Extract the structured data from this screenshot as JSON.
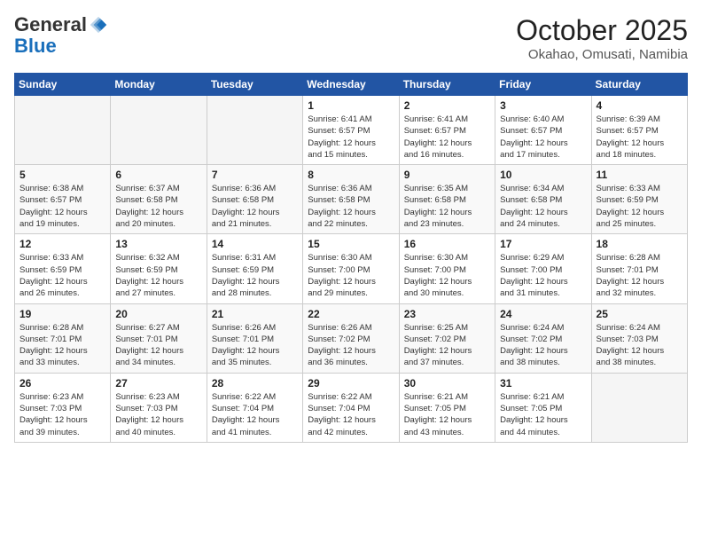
{
  "logo": {
    "general": "General",
    "blue": "Blue"
  },
  "header": {
    "month": "October 2025",
    "location": "Okahao, Omusati, Namibia"
  },
  "days_of_week": [
    "Sunday",
    "Monday",
    "Tuesday",
    "Wednesday",
    "Thursday",
    "Friday",
    "Saturday"
  ],
  "weeks": [
    [
      {
        "day": "",
        "info": ""
      },
      {
        "day": "",
        "info": ""
      },
      {
        "day": "",
        "info": ""
      },
      {
        "day": "1",
        "info": "Sunrise: 6:41 AM\nSunset: 6:57 PM\nDaylight: 12 hours\nand 15 minutes."
      },
      {
        "day": "2",
        "info": "Sunrise: 6:41 AM\nSunset: 6:57 PM\nDaylight: 12 hours\nand 16 minutes."
      },
      {
        "day": "3",
        "info": "Sunrise: 6:40 AM\nSunset: 6:57 PM\nDaylight: 12 hours\nand 17 minutes."
      },
      {
        "day": "4",
        "info": "Sunrise: 6:39 AM\nSunset: 6:57 PM\nDaylight: 12 hours\nand 18 minutes."
      }
    ],
    [
      {
        "day": "5",
        "info": "Sunrise: 6:38 AM\nSunset: 6:57 PM\nDaylight: 12 hours\nand 19 minutes."
      },
      {
        "day": "6",
        "info": "Sunrise: 6:37 AM\nSunset: 6:58 PM\nDaylight: 12 hours\nand 20 minutes."
      },
      {
        "day": "7",
        "info": "Sunrise: 6:36 AM\nSunset: 6:58 PM\nDaylight: 12 hours\nand 21 minutes."
      },
      {
        "day": "8",
        "info": "Sunrise: 6:36 AM\nSunset: 6:58 PM\nDaylight: 12 hours\nand 22 minutes."
      },
      {
        "day": "9",
        "info": "Sunrise: 6:35 AM\nSunset: 6:58 PM\nDaylight: 12 hours\nand 23 minutes."
      },
      {
        "day": "10",
        "info": "Sunrise: 6:34 AM\nSunset: 6:58 PM\nDaylight: 12 hours\nand 24 minutes."
      },
      {
        "day": "11",
        "info": "Sunrise: 6:33 AM\nSunset: 6:59 PM\nDaylight: 12 hours\nand 25 minutes."
      }
    ],
    [
      {
        "day": "12",
        "info": "Sunrise: 6:33 AM\nSunset: 6:59 PM\nDaylight: 12 hours\nand 26 minutes."
      },
      {
        "day": "13",
        "info": "Sunrise: 6:32 AM\nSunset: 6:59 PM\nDaylight: 12 hours\nand 27 minutes."
      },
      {
        "day": "14",
        "info": "Sunrise: 6:31 AM\nSunset: 6:59 PM\nDaylight: 12 hours\nand 28 minutes."
      },
      {
        "day": "15",
        "info": "Sunrise: 6:30 AM\nSunset: 7:00 PM\nDaylight: 12 hours\nand 29 minutes."
      },
      {
        "day": "16",
        "info": "Sunrise: 6:30 AM\nSunset: 7:00 PM\nDaylight: 12 hours\nand 30 minutes."
      },
      {
        "day": "17",
        "info": "Sunrise: 6:29 AM\nSunset: 7:00 PM\nDaylight: 12 hours\nand 31 minutes."
      },
      {
        "day": "18",
        "info": "Sunrise: 6:28 AM\nSunset: 7:01 PM\nDaylight: 12 hours\nand 32 minutes."
      }
    ],
    [
      {
        "day": "19",
        "info": "Sunrise: 6:28 AM\nSunset: 7:01 PM\nDaylight: 12 hours\nand 33 minutes."
      },
      {
        "day": "20",
        "info": "Sunrise: 6:27 AM\nSunset: 7:01 PM\nDaylight: 12 hours\nand 34 minutes."
      },
      {
        "day": "21",
        "info": "Sunrise: 6:26 AM\nSunset: 7:01 PM\nDaylight: 12 hours\nand 35 minutes."
      },
      {
        "day": "22",
        "info": "Sunrise: 6:26 AM\nSunset: 7:02 PM\nDaylight: 12 hours\nand 36 minutes."
      },
      {
        "day": "23",
        "info": "Sunrise: 6:25 AM\nSunset: 7:02 PM\nDaylight: 12 hours\nand 37 minutes."
      },
      {
        "day": "24",
        "info": "Sunrise: 6:24 AM\nSunset: 7:02 PM\nDaylight: 12 hours\nand 38 minutes."
      },
      {
        "day": "25",
        "info": "Sunrise: 6:24 AM\nSunset: 7:03 PM\nDaylight: 12 hours\nand 38 minutes."
      }
    ],
    [
      {
        "day": "26",
        "info": "Sunrise: 6:23 AM\nSunset: 7:03 PM\nDaylight: 12 hours\nand 39 minutes."
      },
      {
        "day": "27",
        "info": "Sunrise: 6:23 AM\nSunset: 7:03 PM\nDaylight: 12 hours\nand 40 minutes."
      },
      {
        "day": "28",
        "info": "Sunrise: 6:22 AM\nSunset: 7:04 PM\nDaylight: 12 hours\nand 41 minutes."
      },
      {
        "day": "29",
        "info": "Sunrise: 6:22 AM\nSunset: 7:04 PM\nDaylight: 12 hours\nand 42 minutes."
      },
      {
        "day": "30",
        "info": "Sunrise: 6:21 AM\nSunset: 7:05 PM\nDaylight: 12 hours\nand 43 minutes."
      },
      {
        "day": "31",
        "info": "Sunrise: 6:21 AM\nSunset: 7:05 PM\nDaylight: 12 hours\nand 44 minutes."
      },
      {
        "day": "",
        "info": ""
      }
    ]
  ]
}
